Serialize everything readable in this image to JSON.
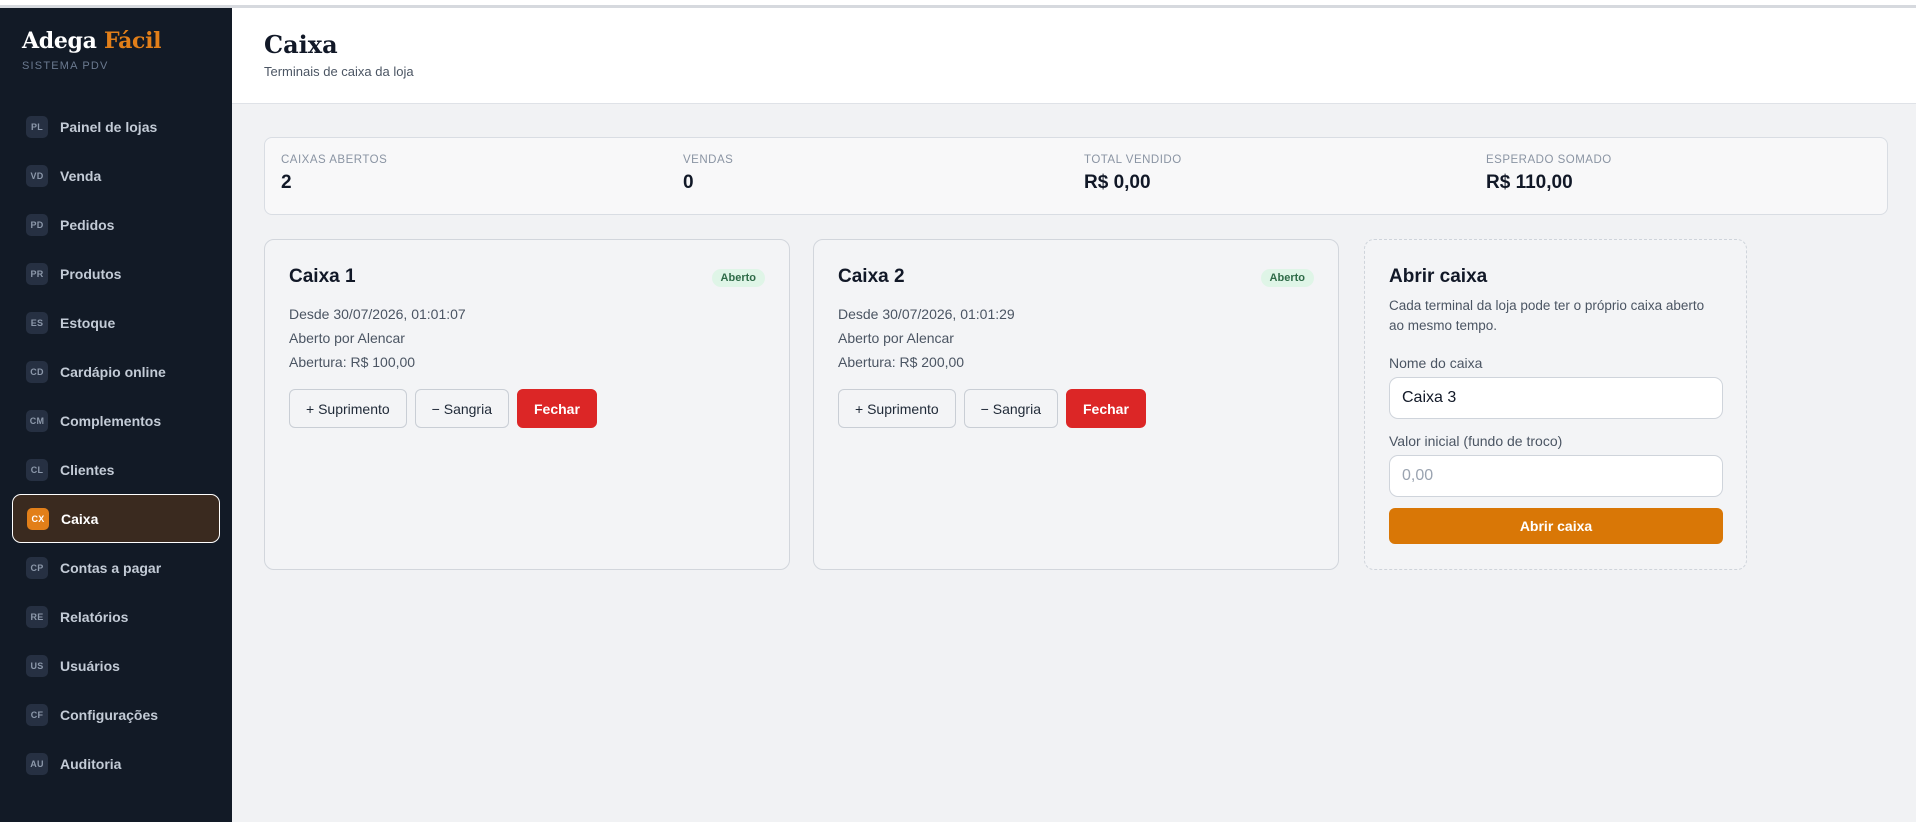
{
  "brand": {
    "name": "Adega",
    "accent": "Fácil",
    "subtitle": "SISTEMA PDV"
  },
  "sidebar": {
    "items": [
      {
        "code": "PL",
        "label": "Painel de lojas"
      },
      {
        "code": "VD",
        "label": "Venda"
      },
      {
        "code": "PD",
        "label": "Pedidos"
      },
      {
        "code": "PR",
        "label": "Produtos"
      },
      {
        "code": "ES",
        "label": "Estoque"
      },
      {
        "code": "CD",
        "label": "Cardápio online"
      },
      {
        "code": "CM",
        "label": "Complementos"
      },
      {
        "code": "CL",
        "label": "Clientes"
      },
      {
        "code": "CX",
        "label": "Caixa",
        "active": true
      },
      {
        "code": "CP",
        "label": "Contas a pagar"
      },
      {
        "code": "RE",
        "label": "Relatórios"
      },
      {
        "code": "US",
        "label": "Usuários"
      },
      {
        "code": "CF",
        "label": "Configurações"
      },
      {
        "code": "AU",
        "label": "Auditoria"
      }
    ]
  },
  "header": {
    "title": "Caixa",
    "subtitle": "Terminais de caixa da loja"
  },
  "stats": [
    {
      "label": "CAIXAS ABERTOS",
      "value": "2"
    },
    {
      "label": "VENDAS",
      "value": "0"
    },
    {
      "label": "TOTAL VENDIDO",
      "value": "R$ 0,00"
    },
    {
      "label": "ESPERADO SOMADO",
      "value": "R$ 110,00"
    }
  ],
  "registers": [
    {
      "title": "Caixa 1",
      "status": "Aberto",
      "since": "Desde 30/07/2026, 01:01:07",
      "opened_by": "Aberto por Alencar",
      "opening": "Abertura: R$ 100,00",
      "btn_supply": "+ Suprimento",
      "btn_withdraw": "− Sangria",
      "btn_close": "Fechar"
    },
    {
      "title": "Caixa 2",
      "status": "Aberto",
      "since": "Desde 30/07/2026, 01:01:29",
      "opened_by": "Aberto por Alencar",
      "opening": "Abertura: R$ 200,00",
      "btn_supply": "+ Suprimento",
      "btn_withdraw": "− Sangria",
      "btn_close": "Fechar"
    }
  ],
  "open_register": {
    "title": "Abrir caixa",
    "description": "Cada terminal da loja pode ter o próprio caixa aberto ao mesmo tempo.",
    "name_label": "Nome do caixa",
    "name_value": "Caixa 3",
    "initial_label": "Valor inicial (fundo de troco)",
    "initial_placeholder": "0,00",
    "initial_value": "",
    "submit_label": "Abrir caixa"
  },
  "colors": {
    "accent": "#e27f19",
    "danger": "#dc2626",
    "sidebar_bg": "#121a26",
    "status_bg": "#dff5e7"
  }
}
